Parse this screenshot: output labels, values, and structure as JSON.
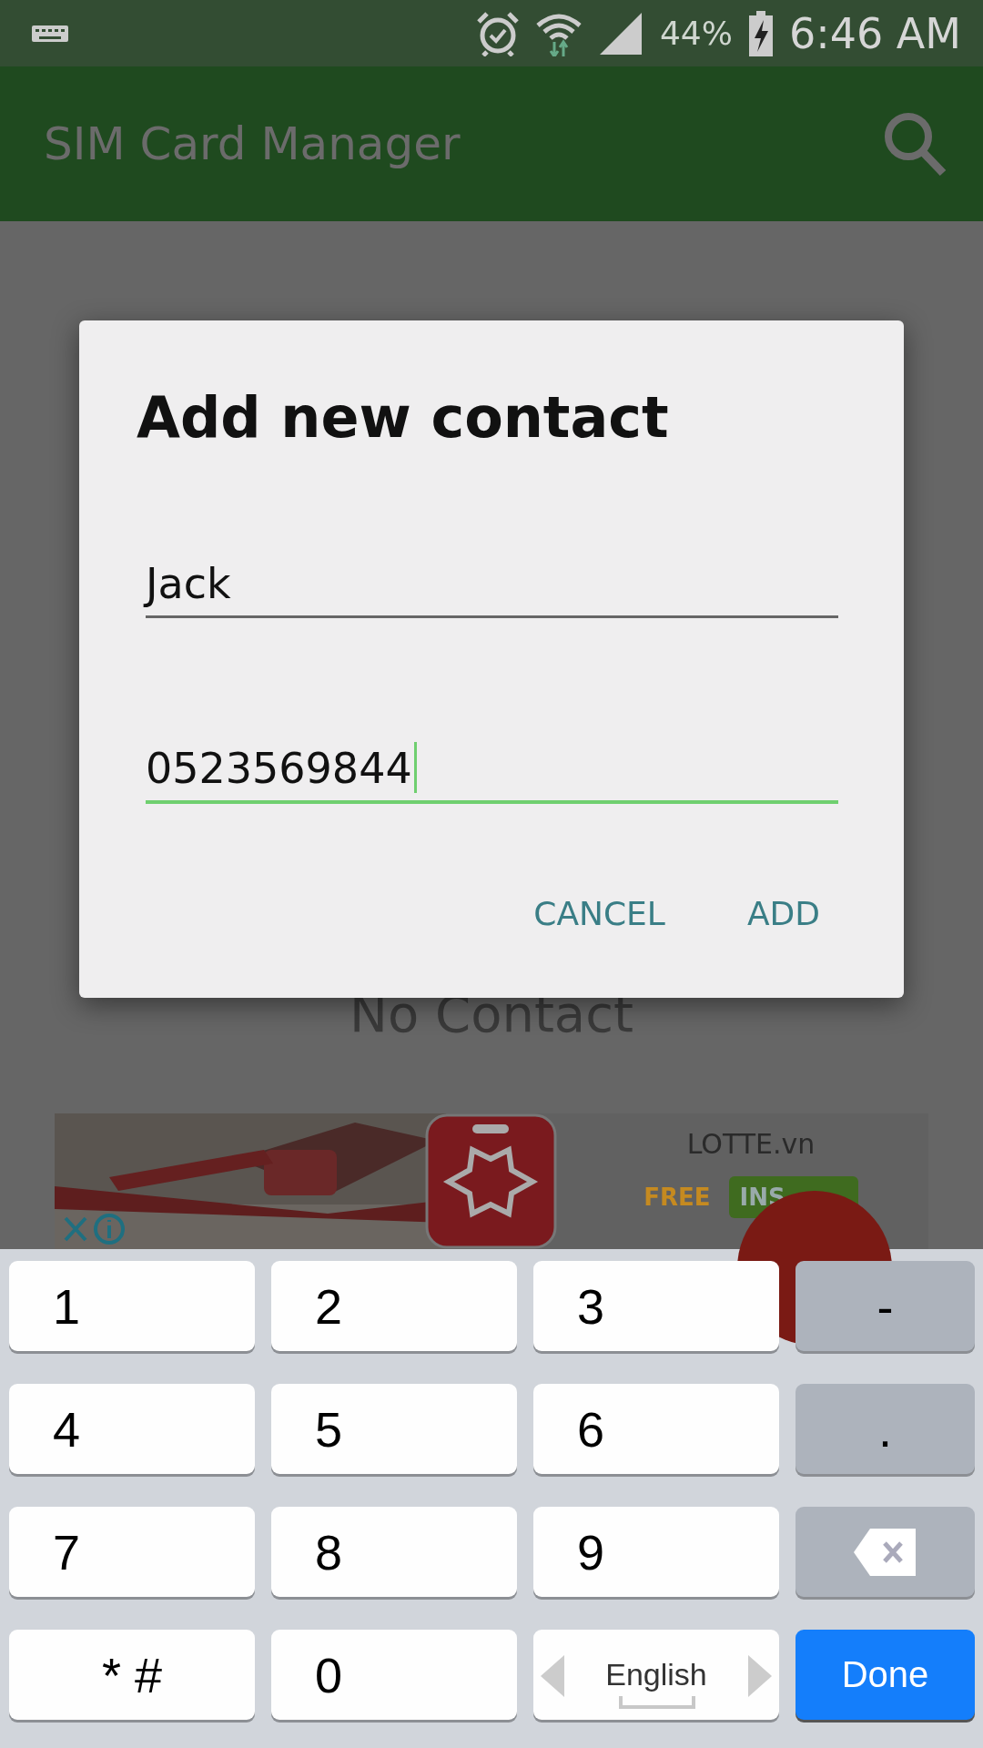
{
  "status_bar": {
    "battery": "44%",
    "time": "6:46 AM"
  },
  "app_bar": {
    "title": "SIM Card Manager"
  },
  "empty_state": {
    "text": "No Contact"
  },
  "ad": {
    "kind": "picture",
    "advertiser": "LOTTE.vn",
    "price": "FREE",
    "install": "INS"
  },
  "dialog": {
    "title": "Add new contact",
    "fields": [
      {
        "value": "Jack",
        "focused": false
      },
      {
        "value": "0523569844",
        "focused": true
      }
    ],
    "buttons": [
      "CANCEL",
      "ADD"
    ]
  },
  "keyboard": {
    "rows": [
      [
        {
          "kind": "digit",
          "label": "1"
        },
        {
          "kind": "digit",
          "label": "2"
        },
        {
          "kind": "digit",
          "label": "3"
        },
        {
          "kind": "symbol",
          "label": "-"
        }
      ],
      [
        {
          "kind": "digit",
          "label": "4"
        },
        {
          "kind": "digit",
          "label": "5"
        },
        {
          "kind": "digit",
          "label": "6"
        },
        {
          "kind": "symbol",
          "label": "."
        }
      ],
      [
        {
          "kind": "digit",
          "label": "7"
        },
        {
          "kind": "digit",
          "label": "8"
        },
        {
          "kind": "digit",
          "label": "9"
        },
        {
          "kind": "backspace"
        }
      ],
      [
        {
          "kind": "digit",
          "label": "* #"
        },
        {
          "kind": "digit",
          "label": "0"
        },
        {
          "kind": "language",
          "label": "English"
        },
        {
          "kind": "action",
          "label": "Done"
        }
      ]
    ]
  }
}
